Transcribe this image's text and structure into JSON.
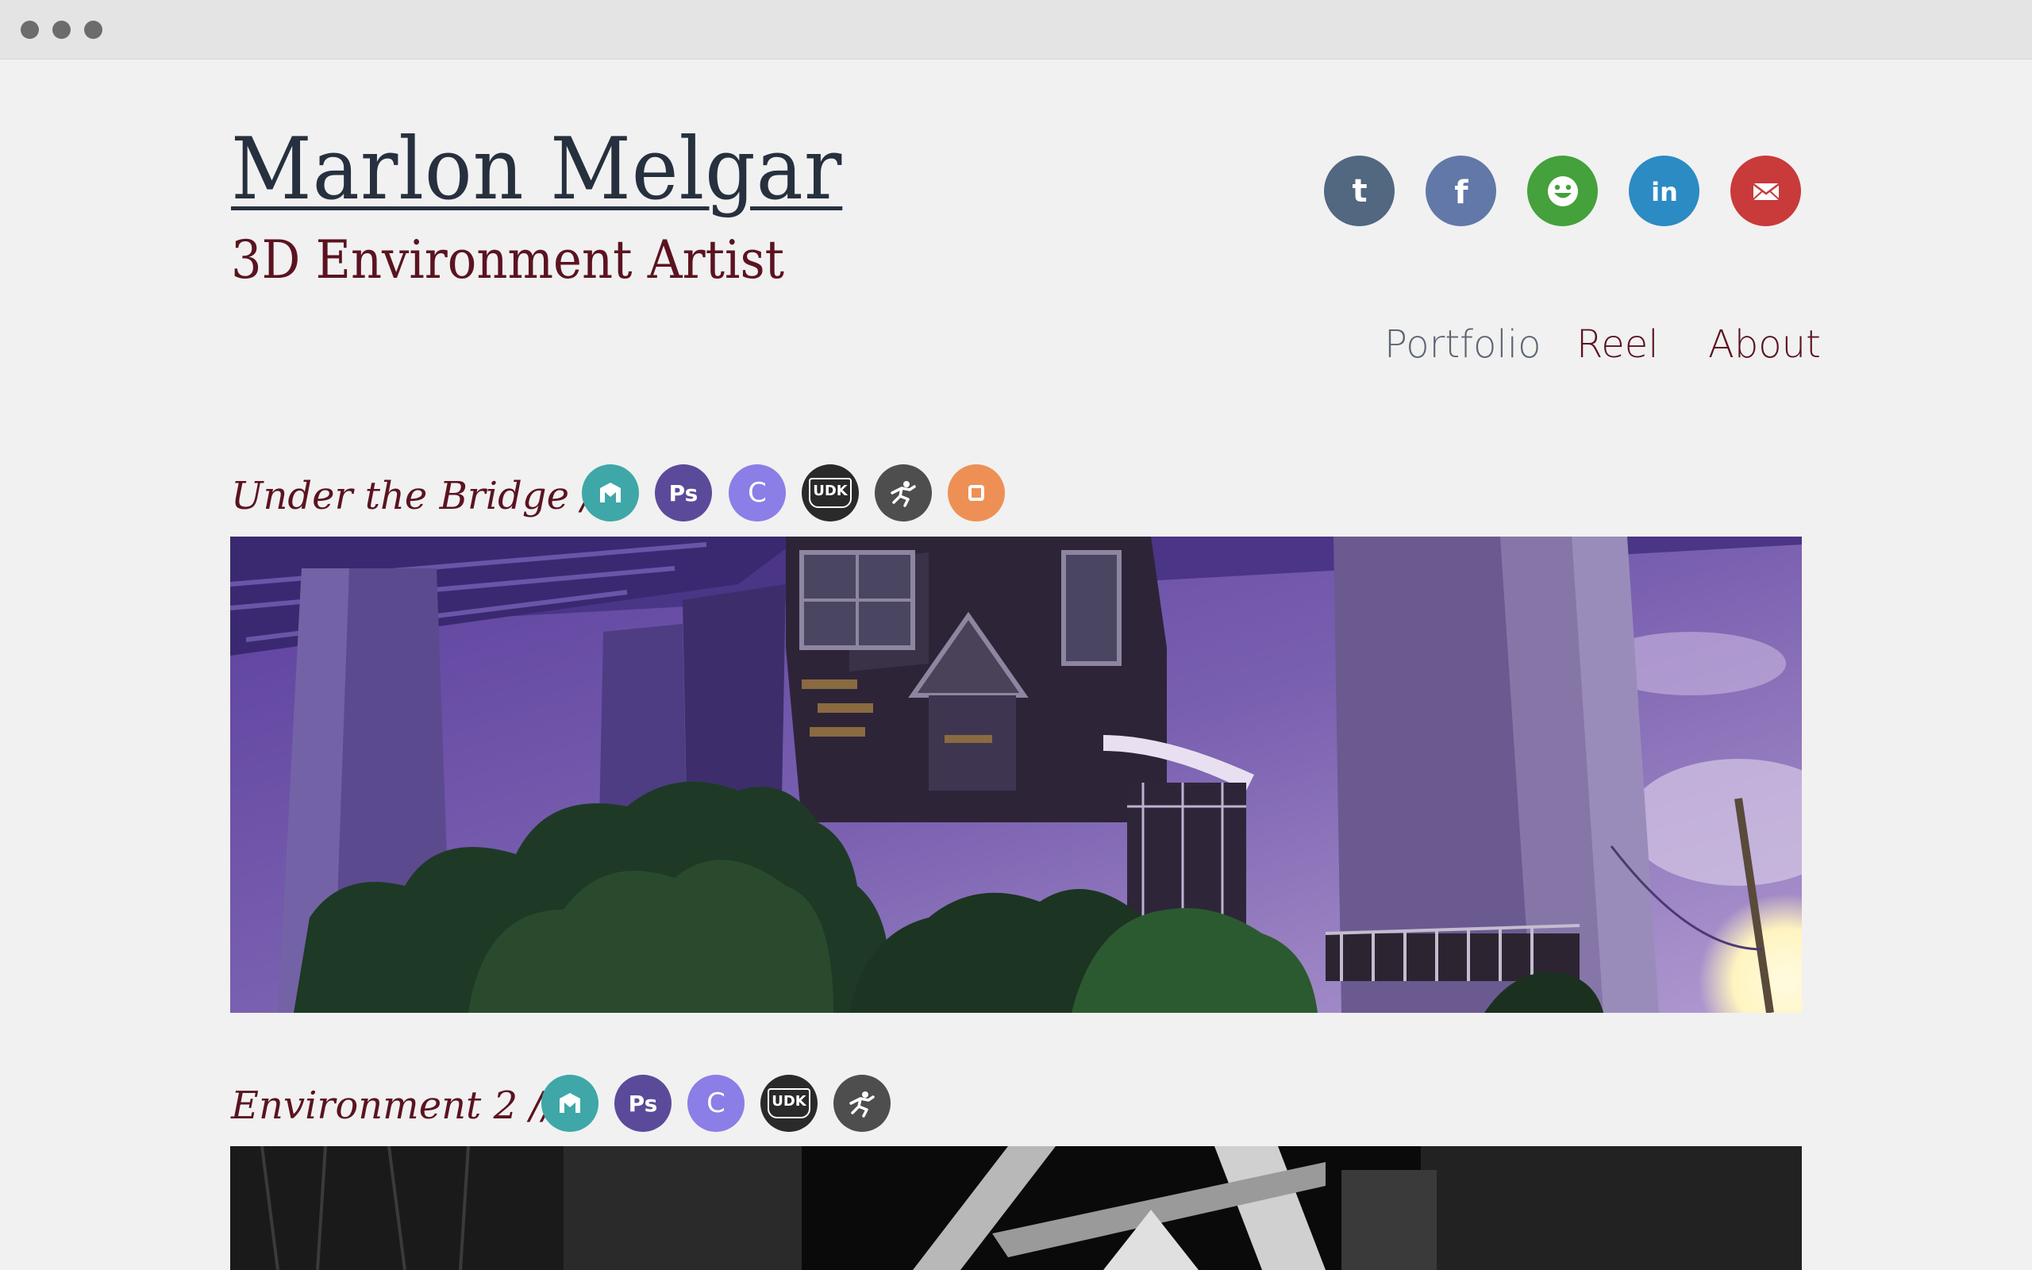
{
  "browser": {
    "dots": [
      "close",
      "minimize",
      "maximize"
    ]
  },
  "header": {
    "name": "Marlon Melgar",
    "role": "3D Environment Artist"
  },
  "social": [
    {
      "name": "tumblr-icon",
      "glyph": "t",
      "color": "#526780"
    },
    {
      "name": "facebook-icon",
      "glyph": "f",
      "color": "#6178a8"
    },
    {
      "name": "smiley-icon",
      "color": "#45a13b"
    },
    {
      "name": "linkedin-icon",
      "glyph": "in",
      "color": "#2c8bc3"
    },
    {
      "name": "mail-icon",
      "color": "#c93a3a"
    }
  ],
  "nav": {
    "portfolio": "Portfolio",
    "reel": "Reel",
    "about": "About"
  },
  "projects": [
    {
      "title": "Under the Bridge",
      "separator": "//",
      "tools": [
        {
          "icon": "marmoset-icon",
          "color": "#3fa7a8"
        },
        {
          "icon": "photoshop-icon",
          "label": "Ps",
          "color": "#5b4a9a"
        },
        {
          "icon": "crazybump-icon",
          "label": "C",
          "color": "#8b7ee6"
        },
        {
          "icon": "udk-icon",
          "label": "UDK",
          "color": "#2a2a2a"
        },
        {
          "icon": "zbrush-icon",
          "color": "#4e4e4e"
        },
        {
          "icon": "substance-icon",
          "color": "#ee9055"
        }
      ],
      "image": "purple-dusk-house-under-bridge"
    },
    {
      "title": "Environment 2",
      "separator": "//",
      "tools": [
        {
          "icon": "marmoset-icon",
          "color": "#3fa7a8"
        },
        {
          "icon": "photoshop-icon",
          "label": "Ps",
          "color": "#5b4a9a"
        },
        {
          "icon": "crazybump-icon",
          "label": "C",
          "color": "#8b7ee6"
        },
        {
          "icon": "udk-icon",
          "label": "UDK",
          "color": "#2a2a2a"
        },
        {
          "icon": "zbrush-icon",
          "color": "#4e4e4e"
        }
      ],
      "image": "grayscale-interior"
    }
  ]
}
